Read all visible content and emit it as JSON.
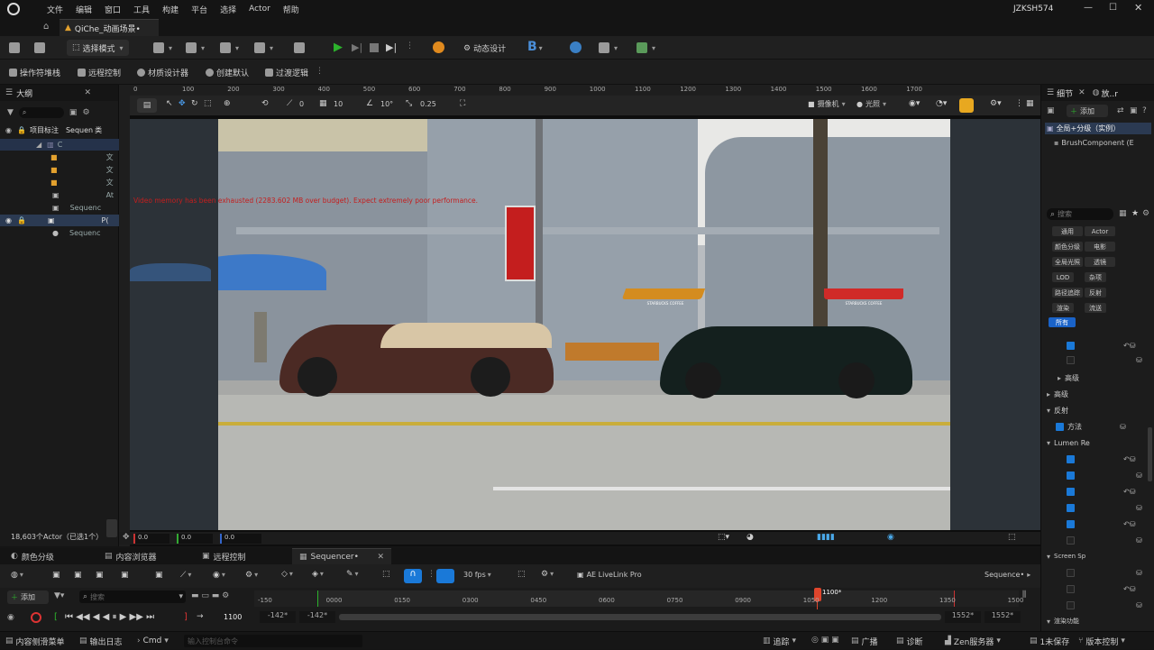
{
  "menu": {
    "items": [
      "文件",
      "编辑",
      "窗口",
      "工具",
      "构建",
      "平台",
      "选择",
      "Actor",
      "帮助"
    ],
    "user": "JZKSH574"
  },
  "tab": {
    "title": "QiChe_动画场景•"
  },
  "toolbar": {
    "mode": "选择模式",
    "dynamic_design": "动态设计"
  },
  "secondary": {
    "items": [
      "操作符堆栈",
      "远程控制",
      "材质设计器",
      "创建默认",
      "过渡逻辑"
    ]
  },
  "outliner": {
    "title": "大纲",
    "root": "项目标注",
    "seq": "Sequen",
    "type_col": "类",
    "rows": [
      "C",
      "文",
      "文",
      "文",
      "At",
      "Sequenc",
      "P(",
      "Sequenc"
    ],
    "footer": "18,603个Actor（已选1个）",
    "coords": [
      "0.0",
      "0.0",
      "0.0"
    ]
  },
  "viewport": {
    "ruler": [
      "100",
      "200",
      "300",
      "400",
      "500",
      "600",
      "700",
      "800",
      "900",
      "1000",
      "1100",
      "1200",
      "1300",
      "1400",
      "1500",
      "1600",
      "1700"
    ],
    "ruler_zero": "0",
    "camera_label": "摄像机",
    "lighting_label": "光照",
    "grid_angle": "10°",
    "grid_size": "10",
    "scale": "0.25",
    "zero": "0",
    "warning": "Video memory has been exhausted (2283.602 MB over budget). Expect extremely poor performance.",
    "stores": [
      "STARBUCKS COFFEE",
      "STARBUCKS COFFEE"
    ]
  },
  "details": {
    "tab1": "细节",
    "tab2": "放..r",
    "add": "添加",
    "component_root": "全局+分级（实例）",
    "component_child": "BrushComponent (E",
    "search_placeholder": "搜索",
    "filters": [
      "通用",
      "Actor",
      "颜色分级",
      "电影",
      "全局光照",
      "透镜",
      "LOD",
      "杂项",
      "路径追踪",
      "反射",
      "渲染",
      "流送",
      "所有"
    ],
    "sections": [
      "高级",
      "高级",
      "反射",
      "方法",
      "Lumen Re",
      "Screen Sp",
      "渲染功能"
    ]
  },
  "bottom": {
    "tabs": [
      "颜色分级",
      "内容浏览器",
      "远程控制",
      "Sequencer•"
    ]
  },
  "sequencer": {
    "add": "添加",
    "search_placeholder": "搜索",
    "fps": "30 fps",
    "plugin": "AE LiveLink Pro",
    "name": "Sequence•",
    "frame": "1100",
    "playhead": "1100*",
    "ticks": [
      "-150",
      "0000",
      "0150",
      "0300",
      "0450",
      "0600",
      "0750",
      "0900",
      "1050",
      "1200",
      "1350",
      "1500"
    ],
    "range_start": "-142*",
    "range_start2": "-142*",
    "range_end": "1552*",
    "range_end2": "1552*"
  },
  "status": {
    "content_drawer": "内容侧滑菜单",
    "output_log": "输出日志",
    "cmd": "Cmd",
    "console_placeholder": "输入控制台命令",
    "trace": "追踪",
    "broadcast": "广播",
    "diagnostics": "诊断",
    "zen": "Zen服务器",
    "unsaved": "1未保存",
    "version": "版本控制"
  },
  "colors": {
    "accent": "#1a79d8",
    "play": "#2cb22c",
    "chip_active": "#1a63c8",
    "playhead": "#e0452c",
    "warning": "#c41e1e"
  }
}
